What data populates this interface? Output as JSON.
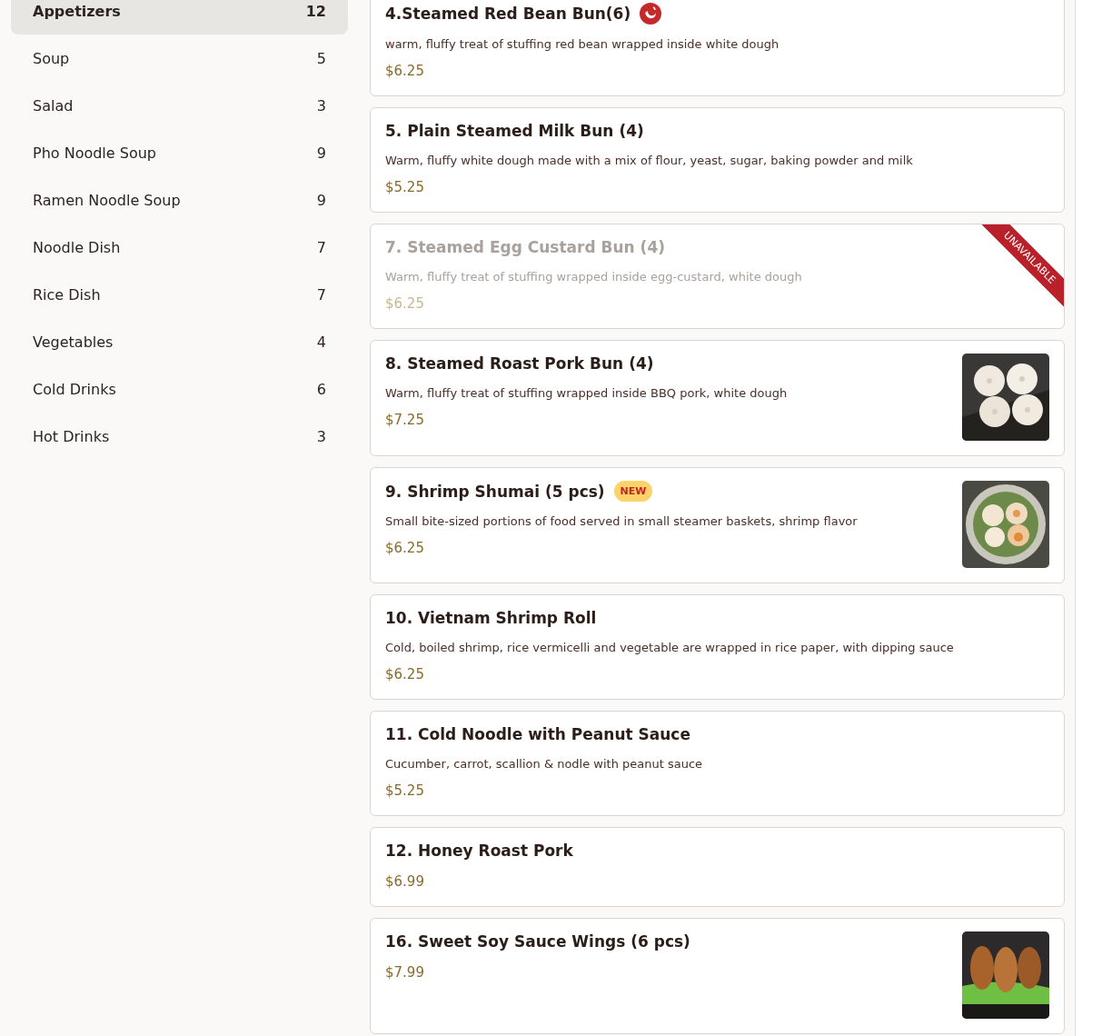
{
  "categories": [
    {
      "name": "Appetizers",
      "count": "12",
      "selected": true
    },
    {
      "name": "Soup",
      "count": "5",
      "selected": false
    },
    {
      "name": "Salad",
      "count": "3",
      "selected": false
    },
    {
      "name": "Pho Noodle Soup",
      "count": "9",
      "selected": false
    },
    {
      "name": "Ramen Noodle Soup",
      "count": "9",
      "selected": false
    },
    {
      "name": "Noodle Dish",
      "count": "7",
      "selected": false
    },
    {
      "name": "Rice Dish",
      "count": "7",
      "selected": false
    },
    {
      "name": "Vegetables",
      "count": "4",
      "selected": false
    },
    {
      "name": "Cold Drinks",
      "count": "6",
      "selected": false
    },
    {
      "name": "Hot Drinks",
      "count": "3",
      "selected": false
    }
  ],
  "menu_items": [
    {
      "title": "4.Steamed Red Bean Bun(6)",
      "spicy": true,
      "description": "warm, fluffy treat of stuffing red bean wrapped inside white dough",
      "price": "$6.25",
      "unavailable": false
    },
    {
      "title": "5. Plain Steamed Milk Bun (4)",
      "description": "Warm, fluffy white dough made with a mix of flour, yeast, sugar, baking powder and milk",
      "price": "$5.25",
      "unavailable": false
    },
    {
      "title": "7. Steamed Egg Custard Bun (4)",
      "description": "Warm, fluffy treat of stuffing wrapped inside egg-custard, white dough",
      "price": "$6.25",
      "unavailable": true,
      "ribbon": "UNAVAILABLE"
    },
    {
      "title": "8. Steamed Roast Pork Bun (4)",
      "description": "Warm, fluffy treat of stuffing wrapped inside BBQ pork, white dough",
      "price": "$7.25",
      "unavailable": false,
      "image": {
        "kind": "buns"
      }
    },
    {
      "title": "9. Shrimp Shumai (5 pcs)",
      "badge": "NEW",
      "description": "Small bite-sized portions of food served in small steamer baskets, shrimp flavor",
      "price": "$6.25",
      "unavailable": false,
      "image": {
        "kind": "bowl"
      }
    },
    {
      "title": "10. Vietnam Shrimp Roll",
      "description": "Cold, boiled shrimp, rice vermicelli and vegetable are wrapped in rice paper, with dipping sauce",
      "price": "$6.25",
      "unavailable": false
    },
    {
      "title": "11. Cold Noodle with Peanut Sauce",
      "description": "Cucumber, carrot, scallion & nodle with peanut sauce",
      "price": "$5.25",
      "unavailable": false
    },
    {
      "title": "12. Honey Roast Pork",
      "price": "$6.99",
      "unavailable": false
    },
    {
      "title": "16. Sweet Soy Sauce Wings (6 pcs)",
      "price": "$7.99",
      "unavailable": false,
      "image": {
        "kind": "wings"
      }
    }
  ]
}
